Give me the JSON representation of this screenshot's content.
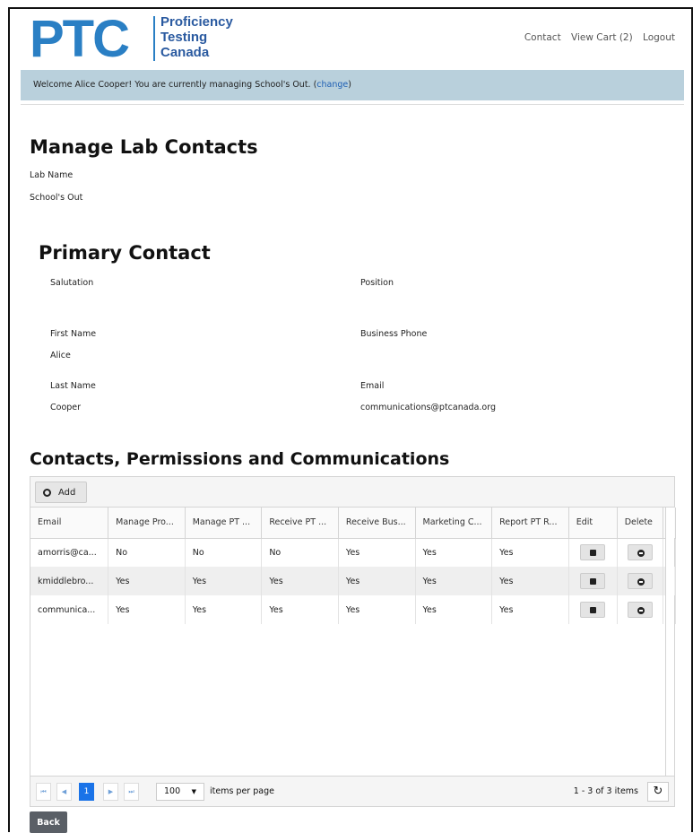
{
  "header": {
    "logo_mark": "PTC",
    "logo_lines": [
      "Proficiency",
      "Testing",
      "Canada"
    ],
    "links": [
      "Contact",
      "View Cart (2)",
      "Logout"
    ]
  },
  "welcome": {
    "text": "Welcome Alice Cooper! You are currently managing School's Out. (",
    "link": "change",
    "suffix": ")"
  },
  "page": {
    "title": "Manage Lab Contacts",
    "lab_name_label": "Lab Name",
    "lab_name_value": "School's Out"
  },
  "primary": {
    "title": "Primary Contact",
    "salutation_label": "Salutation",
    "salutation_value": "",
    "position_label": "Position",
    "position_value": "",
    "first_name_label": "First Name",
    "first_name_value": "Alice",
    "business_phone_label": "Business Phone",
    "business_phone_value": "",
    "last_name_label": "Last Name",
    "last_name_value": "Cooper",
    "email_label": "Email",
    "email_value": "communications@ptcanada.org"
  },
  "contacts": {
    "title": "Contacts, Permissions and Communications",
    "add_label": "Add",
    "columns": [
      "Email",
      "Manage Pro...",
      "Manage PT ...",
      "Receive PT ...",
      "Receive Bus...",
      "Marketing C...",
      "Report PT R...",
      "Edit",
      "Delete"
    ],
    "rows": [
      [
        "amorris@ca...",
        "No",
        "No",
        "No",
        "Yes",
        "Yes",
        "Yes"
      ],
      [
        "kmiddlebro...",
        "Yes",
        "Yes",
        "Yes",
        "Yes",
        "Yes",
        "Yes"
      ],
      [
        "communica...",
        "Yes",
        "Yes",
        "Yes",
        "Yes",
        "Yes",
        "Yes"
      ]
    ]
  },
  "pager": {
    "first": "⏮",
    "prev": "◀",
    "current_page": "1",
    "next": "▶",
    "last": "⏭",
    "page_size": "100",
    "items_per_page": "items per page",
    "count": "1 - 3 of 3 items",
    "refresh_icon": "↻"
  },
  "footer": {
    "back_label": "Back"
  }
}
